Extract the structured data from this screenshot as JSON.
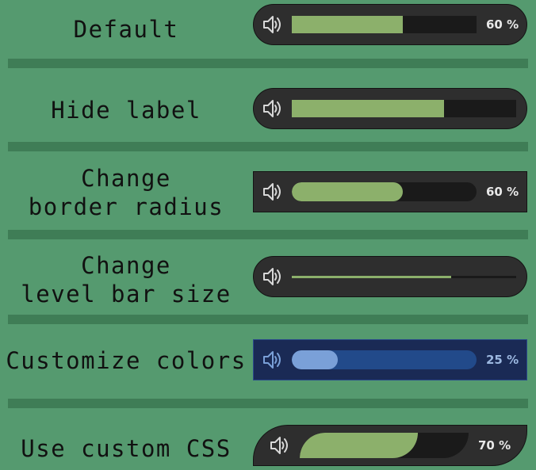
{
  "colors": {
    "page_bg": "#559a6f",
    "divider": "#3f7d56",
    "slider_bg": "#2e2e2e",
    "track_bg": "#1a1a1a",
    "fill_green": "#8cb06b",
    "custom_slider_bg": "#1a2a55",
    "custom_track_bg": "#224a8a",
    "custom_fill": "#7aa0d8",
    "icon_default": "#d8d8d8",
    "icon_custom": "#7aa0d8"
  },
  "rows": [
    {
      "label": "Default",
      "level": 0.6,
      "value_label": "60 %",
      "icon": "speaker-volume-icon"
    },
    {
      "label": "Hide label",
      "level": 0.68,
      "value_label": "",
      "icon": "speaker-volume-icon"
    },
    {
      "label": "Change\nborder radius",
      "level": 0.6,
      "value_label": "60 %",
      "icon": "speaker-volume-icon"
    },
    {
      "label": "Change\nlevel bar size",
      "level": 0.71,
      "value_label": "",
      "icon": "speaker-volume-icon"
    },
    {
      "label": "Customize colors",
      "level": 0.25,
      "value_label": "25 %",
      "icon": "speaker-volume-icon"
    },
    {
      "label": "Use custom CSS",
      "level": 0.7,
      "value_label": "70 %",
      "icon": "speaker-volume-icon"
    }
  ]
}
